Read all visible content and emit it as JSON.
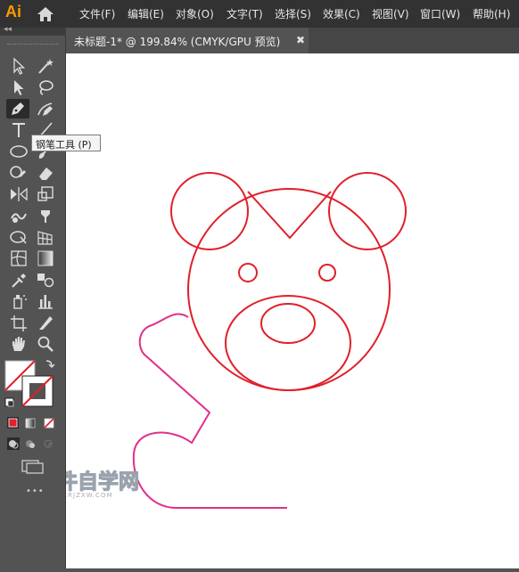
{
  "app": {
    "logo": "Ai",
    "accent": "#ff9a00"
  },
  "menu": [
    "文件(F)",
    "编辑(E)",
    "对象(O)",
    "文字(T)",
    "选择(S)",
    "效果(C)",
    "视图(V)",
    "窗口(W)",
    "帮助(H)"
  ],
  "panel": {
    "collapse": "◂◂"
  },
  "document": {
    "tab_title": "未标题-1* @ 199.84% (CMYK/GPU 预览)",
    "close": "✖"
  },
  "tooltip": "钢笔工具 (P)",
  "tools": [
    "selection-tool",
    "magic-wand-tool",
    "direct-selection-tool",
    "lasso-tool",
    "pen-tool",
    "curvature-tool",
    "type-tool",
    "line-segment-tool",
    "ellipse-tool",
    "paintbrush-tool",
    "shaper-tool",
    "eraser-tool",
    "reflect-tool",
    "scale-tool",
    "warp-tool",
    "free-transform-tool",
    "shape-builder-tool",
    "perspective-grid-tool",
    "mesh-tool",
    "gradient-tool",
    "eyedropper-tool",
    "blend-tool",
    "symbol-sprayer-tool",
    "column-graph-tool",
    "artboard-tool",
    "slice-tool",
    "hand-tool",
    "zoom-tool"
  ],
  "colors": {
    "fill": "#ffffff",
    "stroke": "#ffffff",
    "bear_stroke": "#e0202a",
    "arm_stroke": "#e0308a"
  },
  "watermark": {
    "text": "软件自学网",
    "sub": "WWW.RJZXW.COM"
  }
}
